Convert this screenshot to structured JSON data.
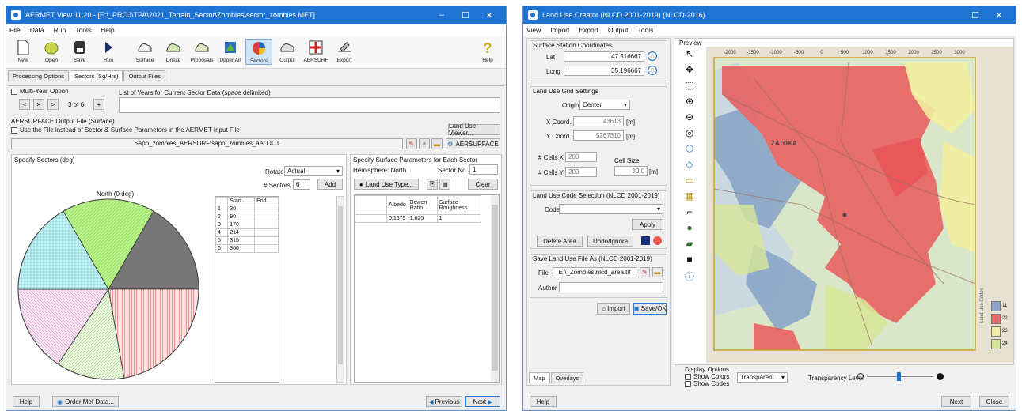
{
  "left_window": {
    "title": "AERMET View 11.20 - [E:\\_PROJ\\TPA\\2021_Terrain_Sector\\Zombies\\sector_zombies.MET]",
    "menu": [
      "File",
      "Data",
      "Run",
      "Tools",
      "Help"
    ],
    "toolbar": [
      "New",
      "Open",
      "Save",
      "Run",
      "Surface",
      "Onsite",
      "Proposals",
      "Upper Air",
      "Sectors",
      "Output",
      "AERSURF",
      "Export",
      "Help"
    ],
    "tabs": [
      "Processing Options",
      "Sectors (Sg/Hrs)",
      "Output Files"
    ],
    "multi_year_label": "Multi-Year Option",
    "years_list_label": "List of Years for Current Sector Data (space delimited)",
    "year_nav": "3 of 6",
    "aersurface_section": "AERSURFACE Output File (Surface)",
    "use_file_label": "Use the File instead of Sector & Surface Parameters in the AERMET Input File",
    "land_use_viewer_button": "Land Use Viewer...",
    "file_path": "Sapo_zombies_AERSURF\\sapo_zombies_aer.OUT",
    "aersurface_button": "AERSURFACE",
    "specify_sectors": "Specify Sectors (deg)",
    "rotate_label": "Rotate",
    "rotate_value": "Actual",
    "num_sectors_label": "# Sectors",
    "num_sectors_value": "6",
    "add_button": "Add",
    "north_label": "North (0 deg)",
    "sector_table_headers": [
      "",
      "Start",
      "End"
    ],
    "sector_table_rows": [
      [
        "1",
        "30",
        ""
      ],
      [
        "2",
        "90",
        ""
      ],
      [
        "3",
        "170",
        ""
      ],
      [
        "4",
        "214",
        ""
      ],
      [
        "5",
        "315",
        ""
      ],
      [
        "6",
        "360",
        ""
      ]
    ],
    "surface_params_title": "Specify Surface Parameters for Each Sector",
    "hemisphere_label": "Hemisphere: North",
    "sector_no_label": "Sector No.",
    "sector_no_value": "1",
    "land_use_type_button": "Land Use Type...",
    "clear_button": "Clear",
    "param_headers": [
      "",
      "Albedo",
      "Bowen Ratio",
      "Surface Roughness"
    ],
    "param_rows": [
      [
        "",
        "0.1575",
        "1.625",
        "1"
      ]
    ],
    "help_button": "Help",
    "order_met_button": "Order Met Data...",
    "previous_button": "Previous",
    "next_button": "Next"
  },
  "right_window": {
    "title": "Land Use Creator (NLCD 2001-2019) (NLCD-2016)",
    "menu": [
      "View",
      "Import",
      "Export",
      "Output",
      "Tools"
    ],
    "surface_coords_title": "Surface Station Coordinates",
    "lat_label": "Lat",
    "lat_value": "47.516667",
    "long_label": "Long",
    "long_value": "35.196667",
    "grid_settings_title": "Land Use Grid Settings",
    "origin_label": "Origin",
    "origin_value": "Center",
    "x_coord_label": "X Coord.",
    "x_coord_value": "43613",
    "y_coord_label": "Y Coord.",
    "y_coord_value": "5267310",
    "unit_m": "[m]",
    "cells_x_label": "# Cells X",
    "cells_x_value": "200",
    "cells_y_label": "# Cells Y",
    "cells_y_value": "200",
    "cell_size_label": "Cell Size",
    "cell_size_value": "30.0",
    "code_selection_title": "Land Use Code Selection (NLCD 2001-2019)",
    "code_label": "Code",
    "apply_button": "Apply",
    "delete_area_button": "Delete Area",
    "undo_button": "Undo/Ignore",
    "save_title": "Save Land Use File As (NLCD 2001-2019)",
    "file_label": "File",
    "file_value": "E:\\_Zombies\\nlcd_area.tif",
    "author_label": "Author",
    "import_button": "Import",
    "export_button": "Save/OK",
    "tabs": [
      "Map",
      "Overlays"
    ],
    "preview_label": "Preview",
    "x_ticks": [
      "-2000",
      "-1500",
      "-1000",
      "-500",
      "0",
      "500",
      "1000",
      "1500",
      "2000",
      "2500",
      "3000"
    ],
    "map_place_label": "ZATOKA",
    "legend_title": "Land Use Codes",
    "legend_items": [
      {
        "code": "11",
        "color": "#8aa5c7"
      },
      {
        "code": "22",
        "color": "#e86a6a"
      },
      {
        "code": "23",
        "color": "#f3eba4"
      },
      {
        "code": "24",
        "color": "#d8e69a"
      }
    ],
    "display_options_title": "Display Options",
    "show_colors_label": "Show Colors",
    "show_codes_label": "Show Codes",
    "transparent_value": "Transparent",
    "transparency_label": "Transparency Level",
    "transparency_level": 0.48,
    "help_button": "Help",
    "next_button": "Next",
    "close_button": "Close"
  }
}
